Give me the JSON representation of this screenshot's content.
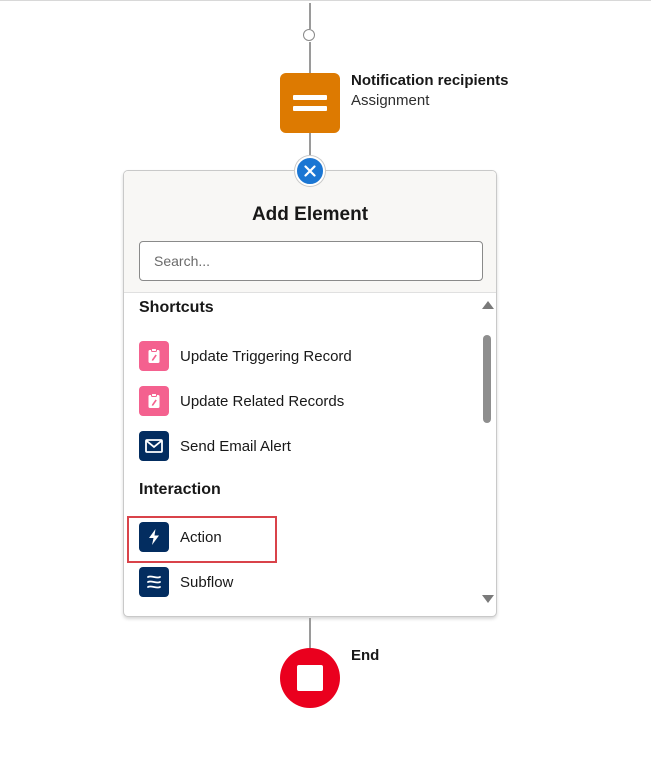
{
  "canvas": {
    "assignment_node": {
      "title": "Notification recipients",
      "subtitle": "Assignment",
      "icon": "assignment-icon",
      "color": "#dd7a01"
    },
    "end_node": {
      "label": "End",
      "icon": "stop-icon",
      "color": "#ea001e"
    }
  },
  "add_element_panel": {
    "title": "Add Element",
    "close_icon": "close-icon",
    "search": {
      "placeholder": "Search...",
      "value": ""
    },
    "sections": [
      {
        "header": "Shortcuts",
        "items": [
          {
            "label": "Update Triggering Record",
            "icon": "clipboard-edit-icon",
            "color": "#f4618f"
          },
          {
            "label": "Update Related Records",
            "icon": "clipboard-edit-icon",
            "color": "#f4618f"
          },
          {
            "label": "Send Email Alert",
            "icon": "email-icon",
            "color": "#032d60"
          }
        ]
      },
      {
        "header": "Interaction",
        "items": [
          {
            "label": "Action",
            "icon": "lightning-icon",
            "color": "#032d60",
            "highlighted": true
          },
          {
            "label": "Subflow",
            "icon": "subflow-icon",
            "color": "#032d60"
          }
        ]
      }
    ]
  },
  "colors": {
    "accent_blue": "#1b76d3",
    "highlight_red": "#d9434a"
  }
}
